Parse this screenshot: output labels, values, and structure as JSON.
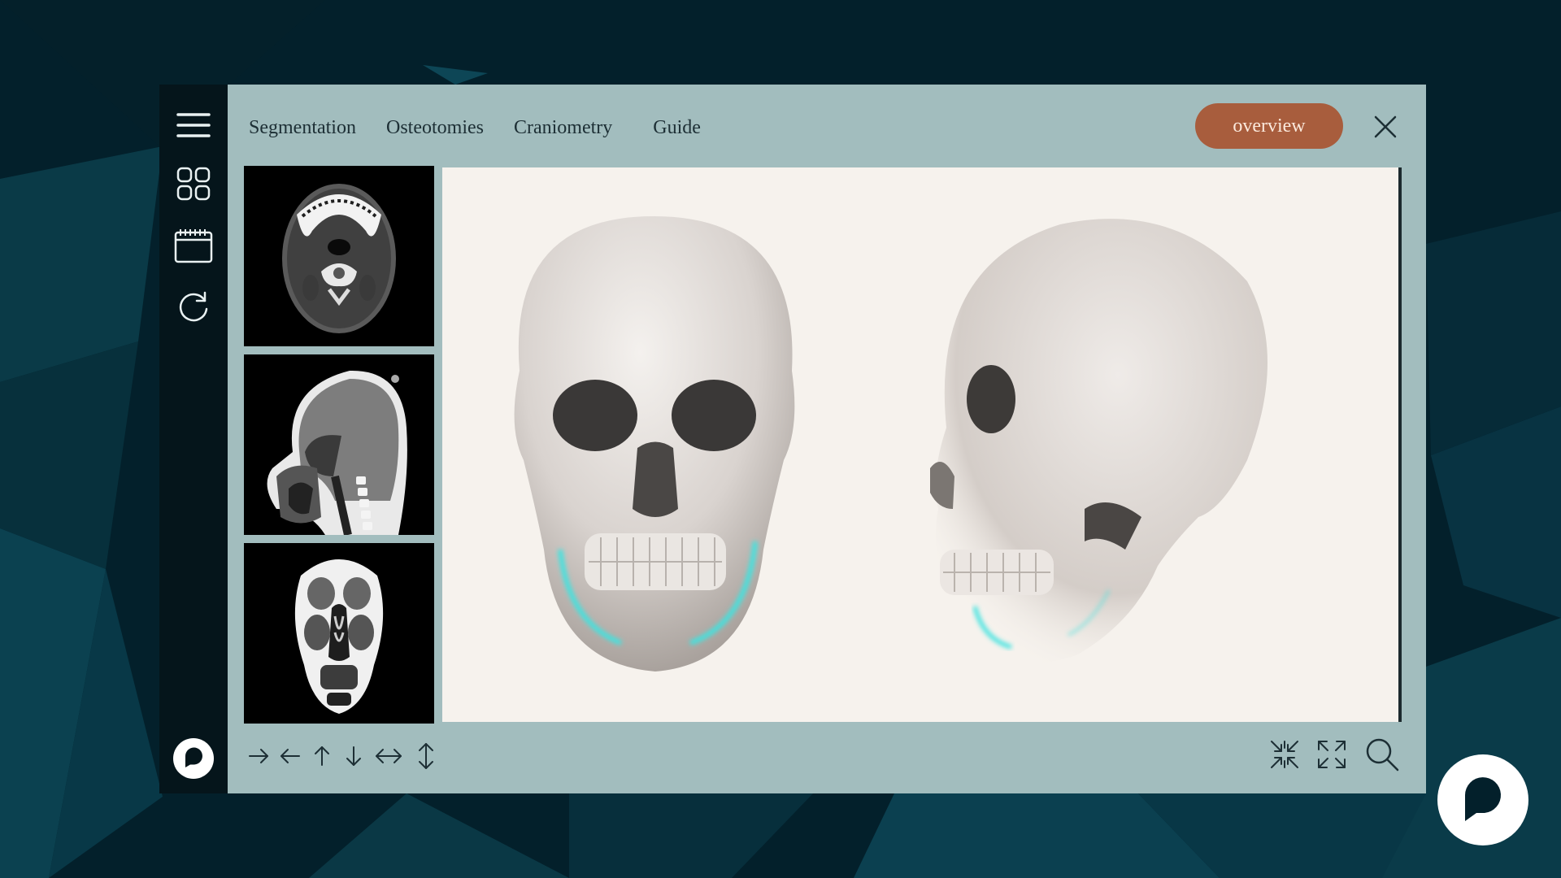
{
  "nav": {
    "tabs": [
      {
        "label": "Segmentation"
      },
      {
        "label": "Osteotomies"
      },
      {
        "label": "Craniometry"
      },
      {
        "label": "Guide"
      }
    ],
    "overview_label": "overview"
  },
  "sidebar": {
    "icons": [
      "hamburger-menu-icon",
      "grid-icon",
      "calendar-icon",
      "refresh-icon"
    ],
    "logo": "chat-logo-icon"
  },
  "thumbnails": [
    {
      "view": "axial-ct-slice"
    },
    {
      "view": "sagittal-ct-slice"
    },
    {
      "view": "coronal-ct-slice"
    }
  ],
  "viewer": {
    "models": [
      "skull-front-view",
      "skull-side-view"
    ],
    "highlight_color": "#3fe3e0"
  },
  "toolbar": {
    "left_icons": [
      "arrow-right-icon",
      "arrow-left-icon",
      "arrow-up-icon",
      "arrow-down-icon",
      "arrow-left-right-icon",
      "arrow-up-down-icon"
    ],
    "right_icons": [
      "collapse-icon",
      "expand-icon",
      "search-icon"
    ]
  },
  "colors": {
    "background": "#062430",
    "sidebar": "#05151b",
    "panel": "#a2bdbe",
    "accent": "#a85d3d",
    "viewer": "#f6f2ed"
  }
}
